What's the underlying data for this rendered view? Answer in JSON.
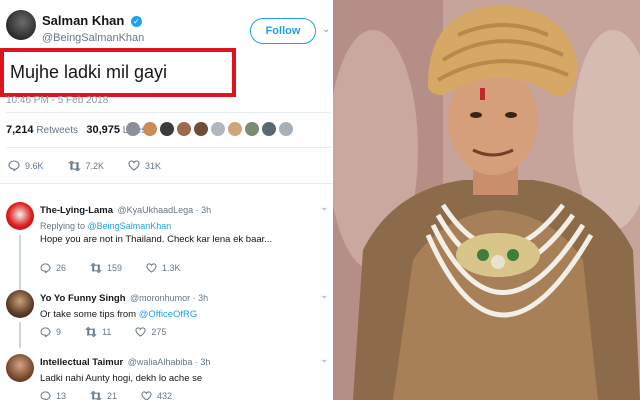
{
  "tweet": {
    "display_name": "Salman Khan",
    "handle": "@BeingSalmanKhan",
    "follow_label": "Follow",
    "text": "Mujhe ladki mil gayi",
    "timestamp": "10:46 PM - 5 Feb 2018",
    "retweets_count": "7,214",
    "retweets_label": "Retweets",
    "likes_count": "30,975",
    "likes_label": "Likes",
    "actions": {
      "replies": "9.6K",
      "retweets": "7.2K",
      "likes": "31K"
    }
  },
  "replies": [
    {
      "name": "The-Lying-Lama",
      "handle": "@KyaUkhaadLega · 3h",
      "replying_prefix": "Replying to ",
      "replying_to": "@BeingSalmanKhan",
      "text": "Hope you are not in Thailand. Check kar lena ek baar...",
      "stats": {
        "replies": "26",
        "retweets": "159",
        "likes": "1.3K"
      }
    },
    {
      "name": "Yo Yo Funny Singh",
      "handle": "@moronhumor · 3h",
      "text_prefix": "Or take some tips from ",
      "text_link": "@OfficeOfRG",
      "stats": {
        "replies": "9",
        "retweets": "11",
        "likes": "275"
      }
    },
    {
      "name": "Intellectual Taimur",
      "handle": "@waliaAlhabiba · 3h",
      "text": "Ladki nahi Aunty hogi, dekh lo ache se",
      "stats": {
        "replies": "13",
        "retweets": "21",
        "likes": "432"
      }
    }
  ],
  "colors": {
    "accent": "#1da1f2",
    "highlight_box": "#e0141e",
    "like": "#e0245e"
  },
  "icons": [
    "verified-icon",
    "chevron-down-icon",
    "reply-icon",
    "retweet-icon",
    "like-icon"
  ]
}
